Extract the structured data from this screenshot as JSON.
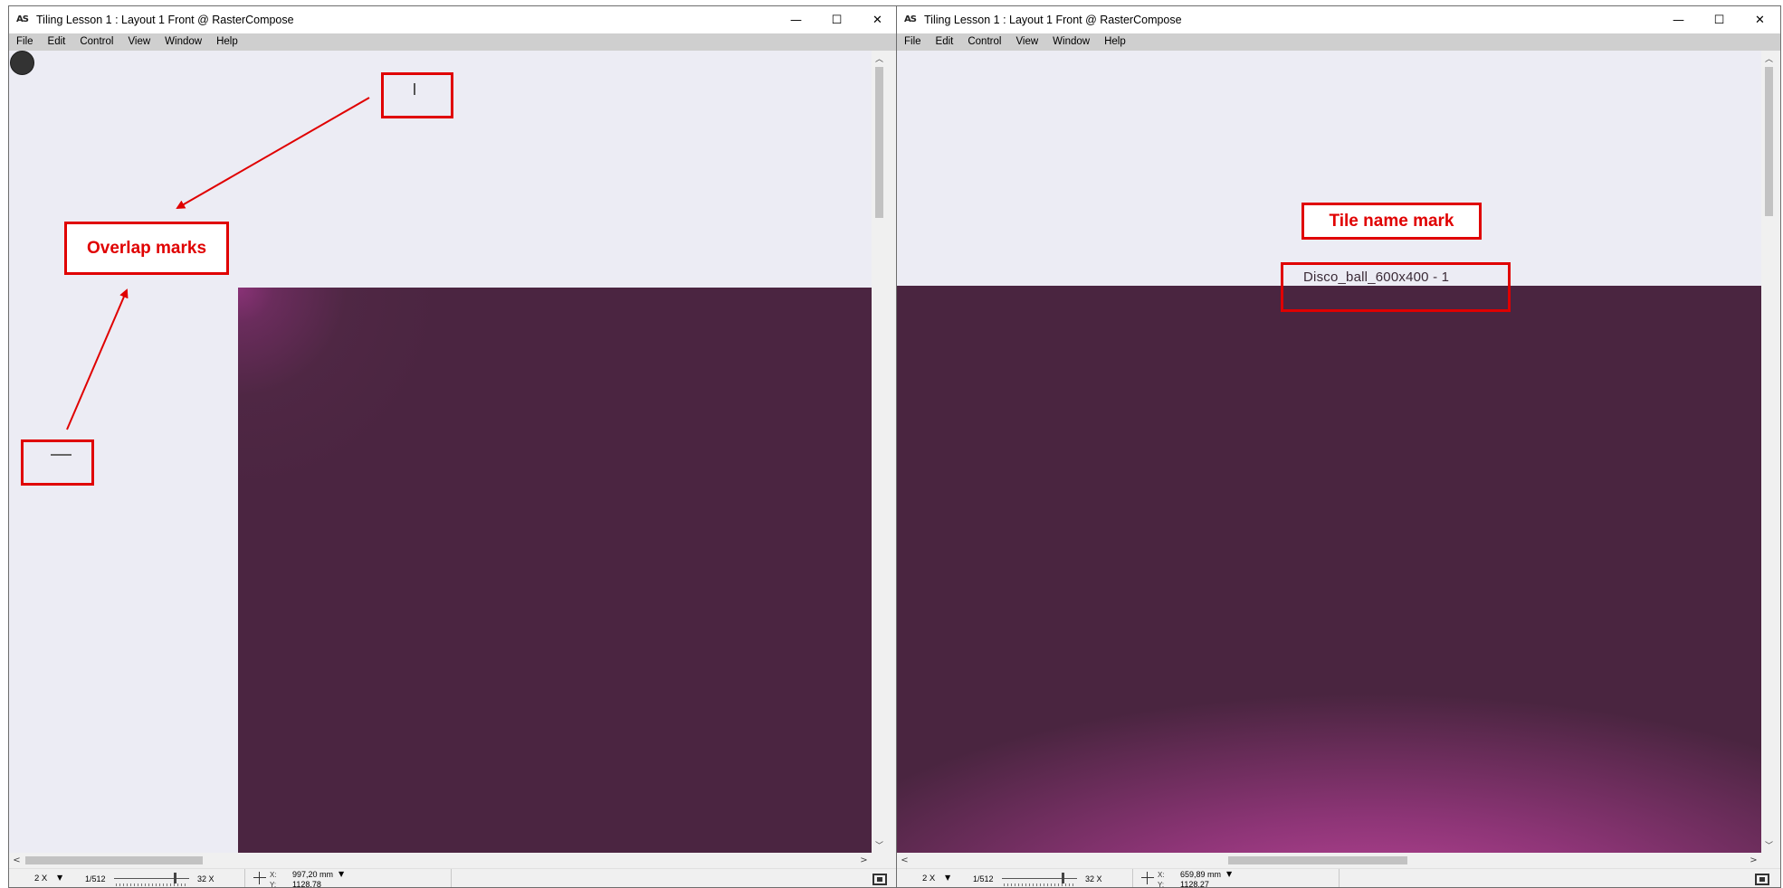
{
  "left_window": {
    "app_icon": "AS",
    "title": "Tiling Lesson 1 : Layout 1 Front @ RasterCompose",
    "controls": {
      "minimize": "—",
      "maximize": "☐",
      "close": "✕"
    },
    "menu": [
      "File",
      "Edit",
      "Control",
      "View",
      "Window",
      "Help"
    ],
    "callout": "Overlap marks",
    "zoom": {
      "factor": "2 X",
      "min": "1/512",
      "max": "32 X",
      "slider_fraction": 0.83
    },
    "coords": {
      "x_label": "X:",
      "x_value": "997,20 mm",
      "y_label": "Y:",
      "y_value": "1128,78"
    }
  },
  "right_window": {
    "app_icon": "AS",
    "title": "Tiling Lesson 1 : Layout 1 Front @ RasterCompose",
    "controls": {
      "minimize": "—",
      "maximize": "☐",
      "close": "✕"
    },
    "menu": [
      "File",
      "Edit",
      "Control",
      "View",
      "Window",
      "Help"
    ],
    "callout": "Tile name mark",
    "tile_name": "Disco_ball_600x400 - 1",
    "zoom": {
      "factor": "2 X",
      "min": "1/512",
      "max": "32 X",
      "slider_fraction": 0.83
    },
    "coords": {
      "x_label": "X:",
      "x_value": "659,89 mm",
      "y_label": "Y:",
      "y_value": "1128,27"
    }
  },
  "glyphs": {
    "drop": "▼",
    "up": "︿",
    "down": "﹀",
    "left": "<",
    "right": ">"
  },
  "colors": {
    "annotation_red": "#e00000",
    "photo_purple": "#4b2540",
    "canvas_bg": "#ececf4"
  }
}
